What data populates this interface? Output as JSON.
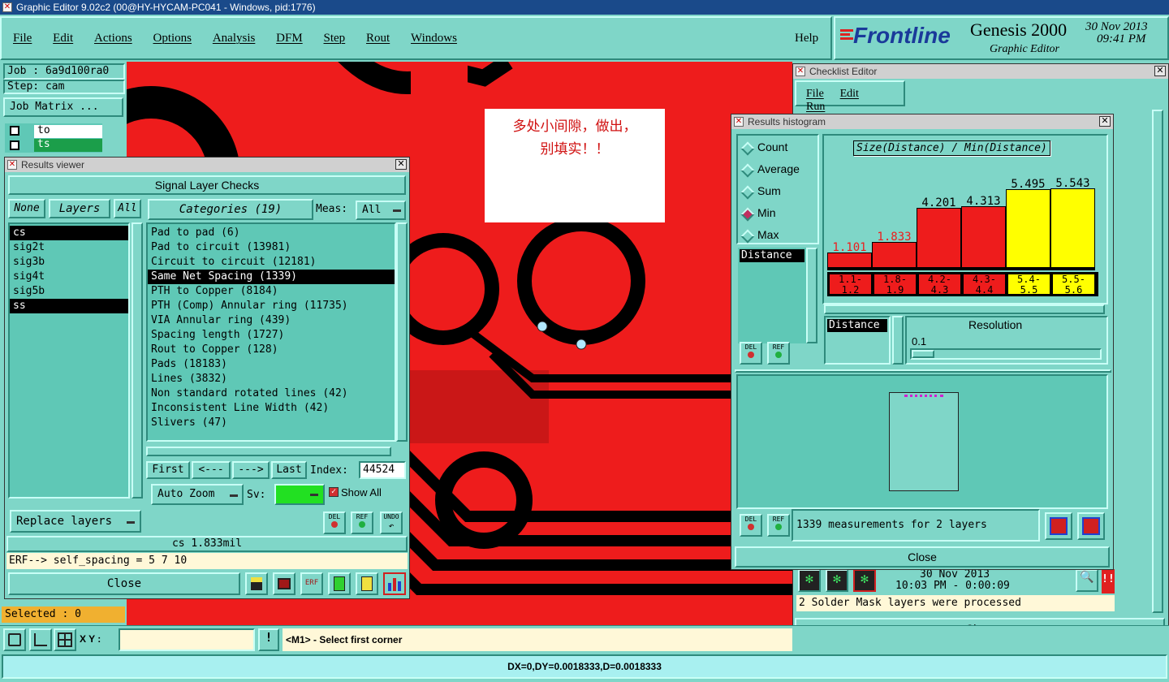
{
  "window_title": "Graphic Editor 9.02c2 (00@HY-HYCAM-PC041 - Windows, pid:1776)",
  "menu": [
    "File",
    "Edit",
    "Actions",
    "Options",
    "Analysis",
    "DFM",
    "Step",
    "Rout",
    "Windows"
  ],
  "help_label": "Help",
  "brand": {
    "logo": "Frontline",
    "product": "Genesis 2000",
    "subtitle": "Graphic Editor",
    "date": "30 Nov 2013",
    "time": "09:41 PM"
  },
  "left_panel": {
    "job": "Job : 6a9d100ra0",
    "step": "Step: cam",
    "job_matrix": "Job Matrix ...",
    "layer1": "to",
    "layer2": "ts",
    "selected": "Selected : 0"
  },
  "note": {
    "line1": "多处小间隙，做出，",
    "line2": "别填实！！"
  },
  "results_viewer": {
    "title": "Results viewer",
    "header": "Signal Layer Checks",
    "none_btn": "None",
    "layers_btn": "Layers",
    "all_btn": "All",
    "categories_btn": "Categories (19)",
    "meas_label": "Meas:",
    "meas_value": "All",
    "layers": [
      "cs",
      "sig2t",
      "sig3b",
      "sig4t",
      "sig5b",
      "ss"
    ],
    "categories": [
      "Pad to pad (6)",
      "Pad to circuit (13981)",
      "Circuit to circuit (12181)",
      "Same Net Spacing (1339)",
      "PTH to Copper (8184)",
      "PTH (Comp) Annular ring (11735)",
      "VIA Annular ring (439)",
      "Spacing length (1727)",
      "Rout to Copper (128)",
      "Pads (18183)",
      "Lines (3832)",
      "Non standard rotated lines (42)",
      "Inconsistent Line Width (42)",
      "Slivers (47)"
    ],
    "first": "First",
    "prev": "<---",
    "next": "--->",
    "last": "Last",
    "index_label": "Index:",
    "index_value": "44524",
    "auto_zoom": "Auto Zoom",
    "sv_label": "Sv:",
    "show_all": "Show All",
    "replace_layers": "Replace layers",
    "del": "DEL",
    "ref": "REF",
    "undo": "UNDO",
    "status": "cs 1.833mil",
    "erf": "ERF--> self_spacing = 5 7 10",
    "close": "Close"
  },
  "checklist": {
    "title": "Checklist Editor",
    "menu": [
      "File",
      "Edit",
      "Run"
    ],
    "date": "30 Nov 2013",
    "time": "10:03 PM - 0:00:09",
    "message": "2 Solder Mask layers were processed",
    "close": "Close"
  },
  "histogram": {
    "title": "Results histogram",
    "options": [
      "Count",
      "Average",
      "Sum",
      "Min",
      "Max"
    ],
    "selected_option": "Min",
    "chart_title": "Size(Distance) / Min(Distance)",
    "list_item": "Distance",
    "resolution_label": "Resolution",
    "resolution_value": "0.1",
    "distance_label": "Distance",
    "del": "DEL",
    "ref": "REF",
    "summary": "1339 measurements for 2 layers",
    "close": "Close"
  },
  "chart_data": {
    "type": "bar",
    "title": "Size(Distance) / Min(Distance)",
    "categories": [
      "1.1-\n1.2",
      "1.8-\n1.9",
      "4.2-\n4.3",
      "4.3-\n4.4",
      "5.4-\n5.5",
      "5.5-\n5.6"
    ],
    "values": [
      1.101,
      1.833,
      4.201,
      4.313,
      5.495,
      5.543
    ],
    "value_labels": [
      "1.101",
      "1.833",
      "4.201",
      "4.313",
      "5.495",
      "5.543"
    ],
    "colors": [
      "#ee1c1c",
      "#ee1c1c",
      "#ee1c1c",
      "#ee1c1c",
      "#ffff00",
      "#ffff00"
    ],
    "label_colors": [
      "#ee1c1c",
      "#ee1c1c",
      "#000000",
      "#000000",
      "#000000",
      "#000000"
    ],
    "ylim": [
      0,
      6
    ]
  },
  "bottom": {
    "xy_label": "X Y :",
    "hint": "<M1> - Select first corner",
    "coords": "DX=0,DY=0.0018333,D=0.0018333"
  },
  "colors": {
    "teal": "#7fd6c8",
    "copper": "#ee1c1c",
    "title_blue": "#1a4a8a"
  }
}
